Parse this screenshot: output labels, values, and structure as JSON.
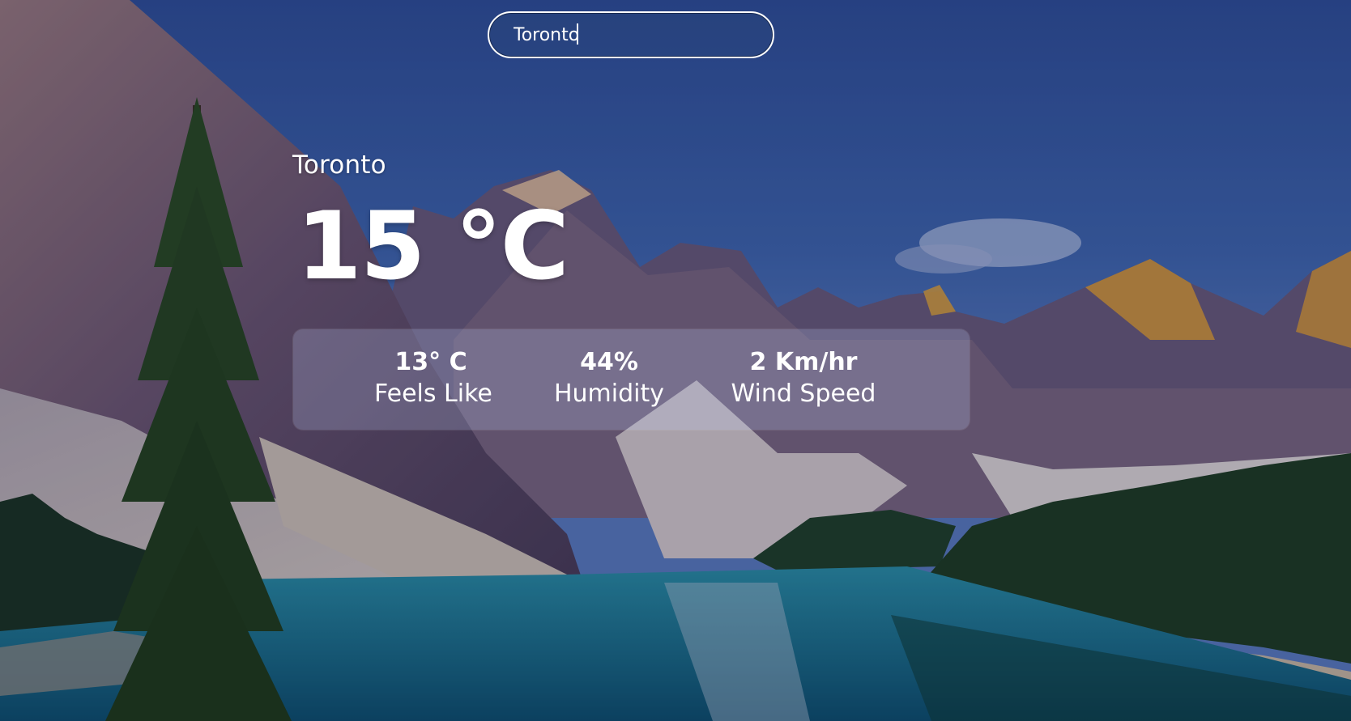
{
  "search": {
    "value": "Toronto",
    "placeholder": ""
  },
  "weather": {
    "city": "Toronto",
    "temperature": "15 °C",
    "stats": [
      {
        "value": "13° C",
        "label": "Feels Like"
      },
      {
        "value": "44%",
        "label": "Humidity"
      },
      {
        "value": "2 Km/hr",
        "label": "Wind Speed"
      }
    ]
  },
  "colors": {
    "text": "#ffffff",
    "sky": "#2a4f9a",
    "lake": "#1d6f8e",
    "forest": "#1f3a1f"
  }
}
